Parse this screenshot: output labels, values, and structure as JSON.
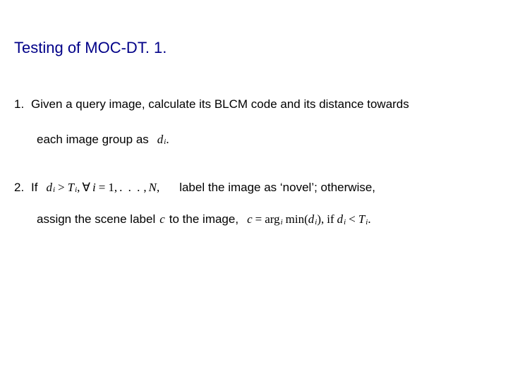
{
  "title": "Testing of MOC-DT. 1.",
  "item1": {
    "num": "1.",
    "text_a": "Given a query image, calculate its BLCM code and its distance towards",
    "text_b": "each image group as",
    "formula": {
      "d": "d",
      "i": "i",
      "dot": "."
    }
  },
  "item2": {
    "num": "2.",
    "if": "If",
    "cond": {
      "d": "d",
      "i1": "i",
      "gt": ">",
      "T": "T",
      "i2": "i",
      "comma1": ",",
      "forall": "∀",
      "i3": "i",
      "eq": "=",
      "one": "1",
      "comma2": ",",
      "dots": ". . .",
      "comma3": ",",
      "N": "N",
      "comma4": ","
    },
    "after_cond": "label the image as ‘novel’;  otherwise,",
    "line2_a": "assign the scene label",
    "c_var": "c",
    "line2_b": "to the image,",
    "assign": {
      "c": "c",
      "eq": "=",
      "arg": "arg",
      "sub_i": "i",
      "min": "min",
      "lp": "(",
      "d": "d",
      "i": "i",
      "rp": ")",
      "comma": ",",
      "if": "if",
      "d2": "d",
      "i2": "i",
      "lt": "<",
      "T": "T",
      "i3": "i",
      "dot": "."
    }
  }
}
